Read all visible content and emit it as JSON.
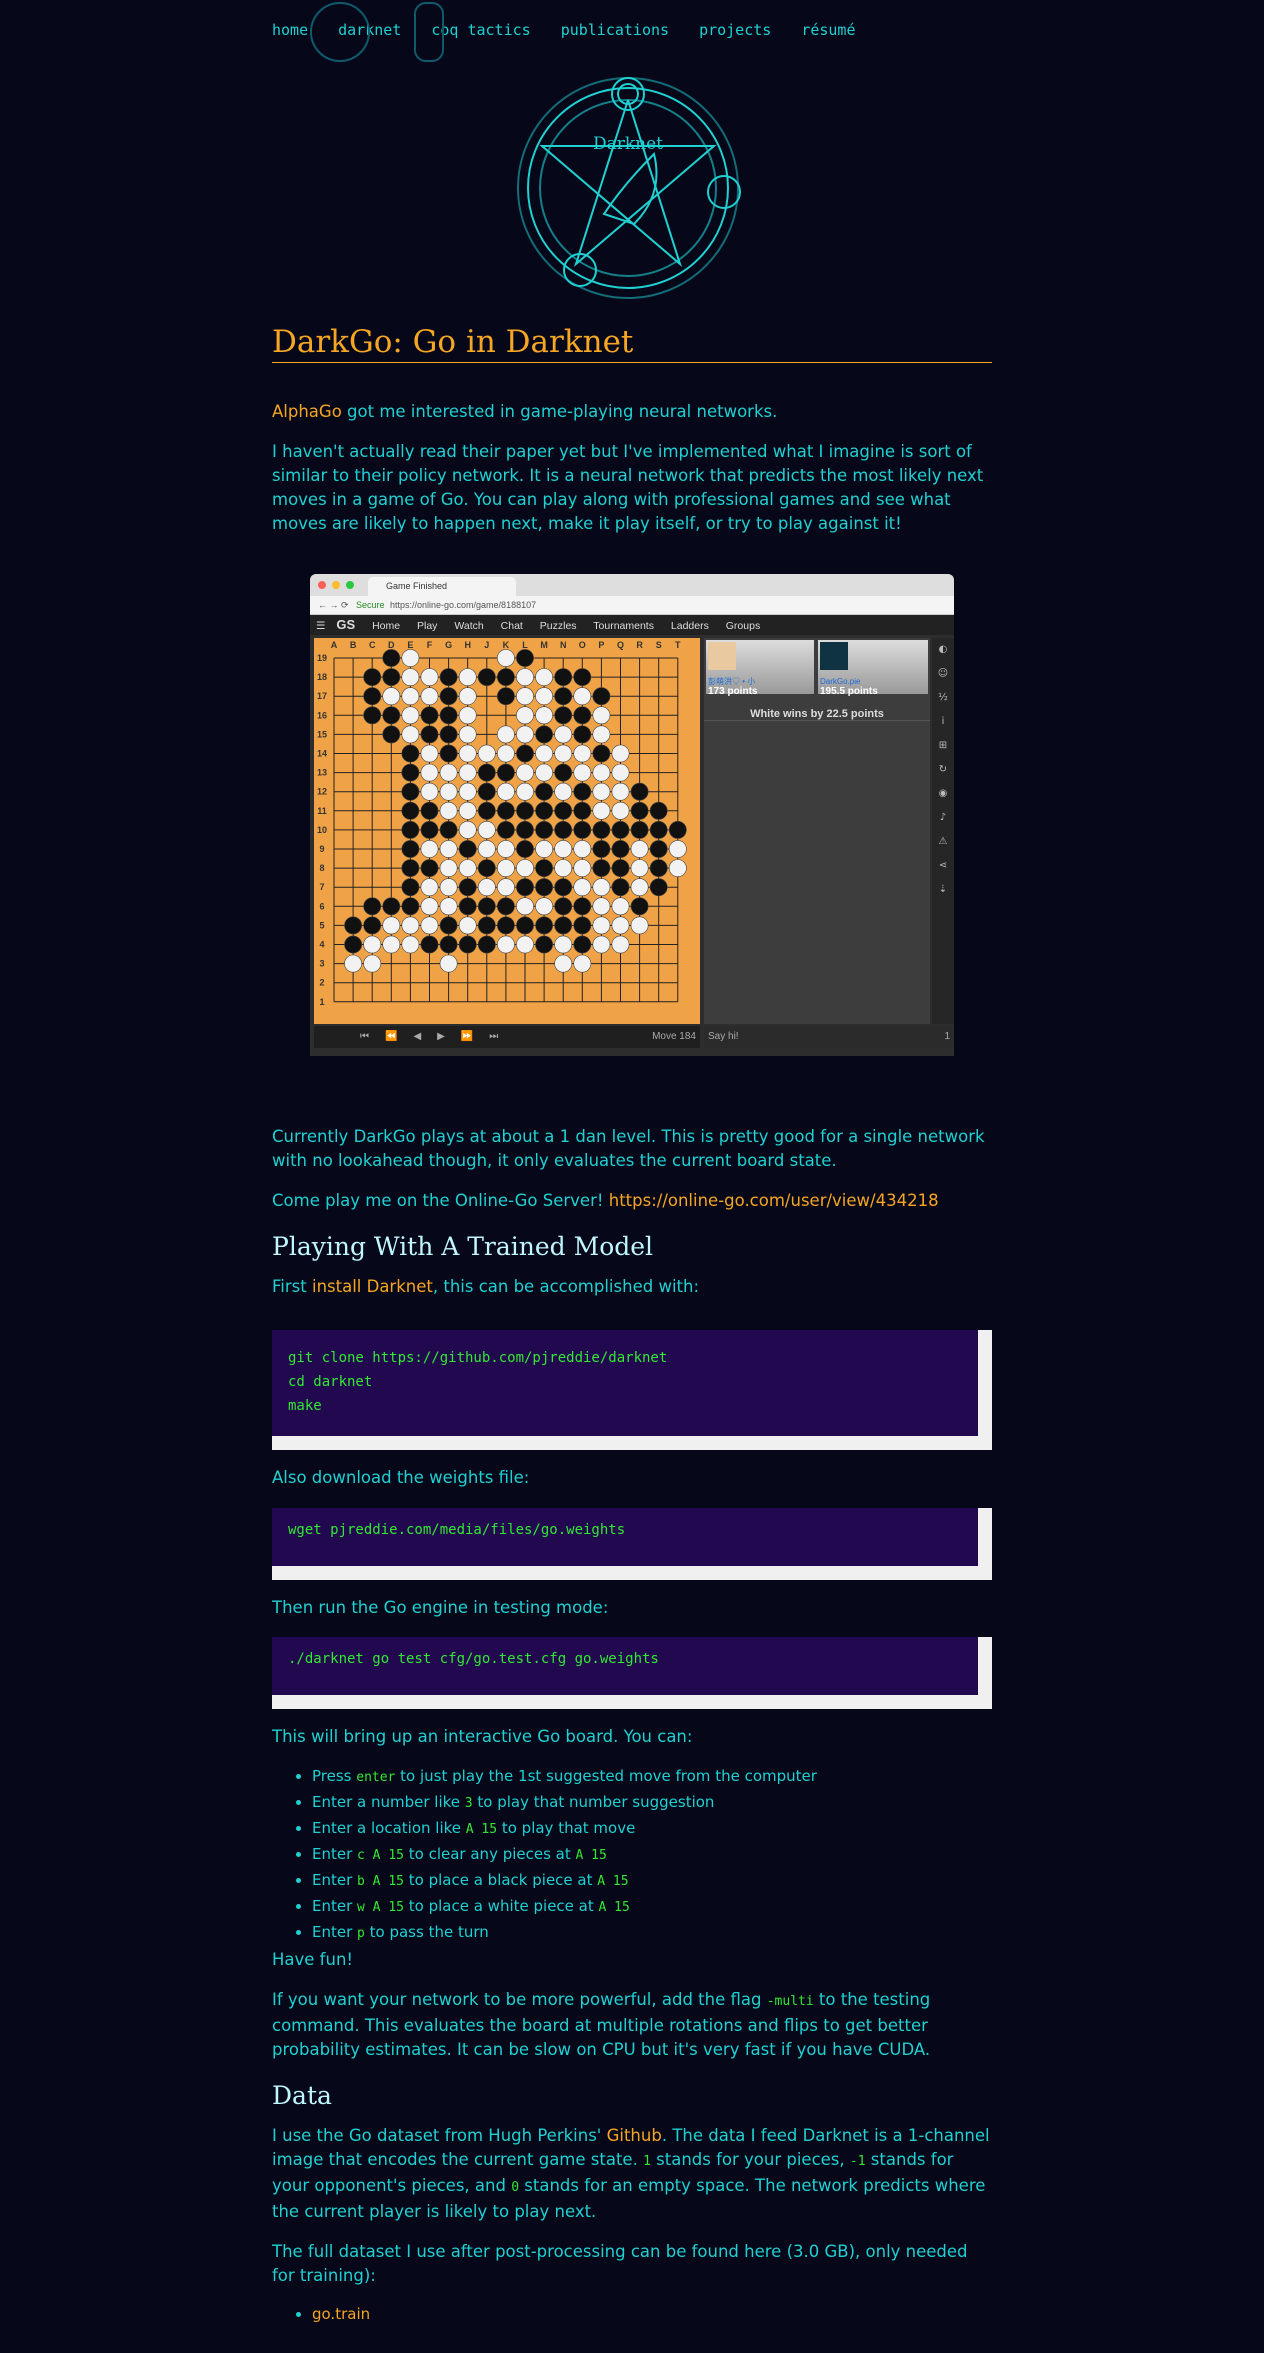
{
  "nav": {
    "home": "home",
    "darknet": "darknet",
    "coq": "coq tactics",
    "publications": "publications",
    "projects": "projects",
    "resume": "résumé"
  },
  "logo": {
    "title": "Darknet"
  },
  "page": {
    "title": "DarkGo: Go in Darknet",
    "intro_link": "AlphaGo",
    "intro_rest": " got me interested in game-playing neural networks.",
    "para2": "I haven't actually read their paper yet but I've implemented what I imagine is sort of similar to their policy network. It is a neural network that predicts the most likely next moves in a game of Go. You can play along with professional games and see what moves are likely to happen next, make it play itself, or try to play against it!",
    "level": "Currently DarkGo plays at about a 1 dan level. This is pretty good for a single network with no lookahead though, it only evaluates the current board state.",
    "play_me": "Come play me on the Online-Go Server! ",
    "play_link": "https://online-go.com/user/view/434218",
    "h_trained": "Playing With A Trained Model",
    "first_pre": "First ",
    "first_link": "install Darknet",
    "first_post": ", this can be accomplished with:",
    "code1": "git clone https://github.com/pjreddie/darknet\ncd darknet\nmake",
    "weights": "Also download the weights file:",
    "code2": "wget pjreddie.com/media/files/go.weights",
    "testing": "Then run the Go engine in testing mode:",
    "code3": "./darknet go test cfg/go.test.cfg go.weights",
    "interactive": "This will bring up an interactive Go board. You can:",
    "have_fun": "Have fun!",
    "multi_pre": "If you want your network to be more powerful, add the flag ",
    "multi_flag": "-multi",
    "multi_post": " to the testing command. This evaluates the board at multiple rotations and flips to get better probability estimates. It can be slow on CPU but it's very fast if you have CUDA.",
    "h_data": "Data",
    "data_pre": "I use the Go dataset from Hugh Perkins' ",
    "data_link": "Github",
    "data_mid1": ". The data I feed Darknet is a 1-channel image that encodes the current game state. ",
    "data_one": "1",
    "data_mid2": " stands for your pieces, ",
    "data_neg": "-1",
    "data_mid3": " stands for your opponent's pieces, and ",
    "data_zero": "0",
    "data_post": " stands for an empty space. The network predicts where the current player is likely to play next.",
    "full_pre": "The full dataset I use after post-processing can be found ",
    "full_link": "here",
    "full_post": " (3.0 GB), only needed for training):",
    "train_link": "go.train"
  },
  "bullets": [
    {
      "a": "Press ",
      "c": "enter",
      "b": " to just play the 1st suggested move from the computer"
    },
    {
      "a": "Enter a number like ",
      "c": "3",
      "b": " to play that number suggestion"
    },
    {
      "a": "Enter a location like ",
      "c": "A 15",
      "b": " to play that move"
    },
    {
      "a": "Enter ",
      "c": "c A 15",
      "b": " to clear any pieces at ",
      "c2": "A 15"
    },
    {
      "a": "Enter ",
      "c": "b A 15",
      "b": " to place a black piece at ",
      "c2": "A 15"
    },
    {
      "a": "Enter ",
      "c": "w A 15",
      "b": " to place a white piece at ",
      "c2": "A 15"
    },
    {
      "a": "Enter ",
      "c": "p",
      "b": " to pass the turn"
    }
  ],
  "screenshot": {
    "tab_title": "Game Finished",
    "secure": "Secure",
    "url": "https://online-go.com/game/8188107",
    "logo": "GS",
    "menu": [
      "Home",
      "Play",
      "Watch",
      "Chat",
      "Puzzles",
      "Tournaments",
      "Ladders",
      "Groups"
    ],
    "columns": [
      "A",
      "B",
      "C",
      "D",
      "E",
      "F",
      "G",
      "H",
      "J",
      "K",
      "L",
      "M",
      "N",
      "O",
      "P",
      "Q",
      "R",
      "S",
      "T"
    ],
    "player1_name": "彭萌洪♡ • 小",
    "player1_points": "173 points",
    "player2_name": "DarkGo.pie",
    "player2_points": "195.5 points",
    "result": "White wins by 22.5 points",
    "move": "Move 184",
    "chat_placeholder": "Say hi!",
    "viewers": "1"
  },
  "colors": {
    "accent": "#f5a623",
    "text": "#1fd1d1",
    "code_bg": "#22094f",
    "code_text": "#33e833",
    "background": "#07071a"
  }
}
